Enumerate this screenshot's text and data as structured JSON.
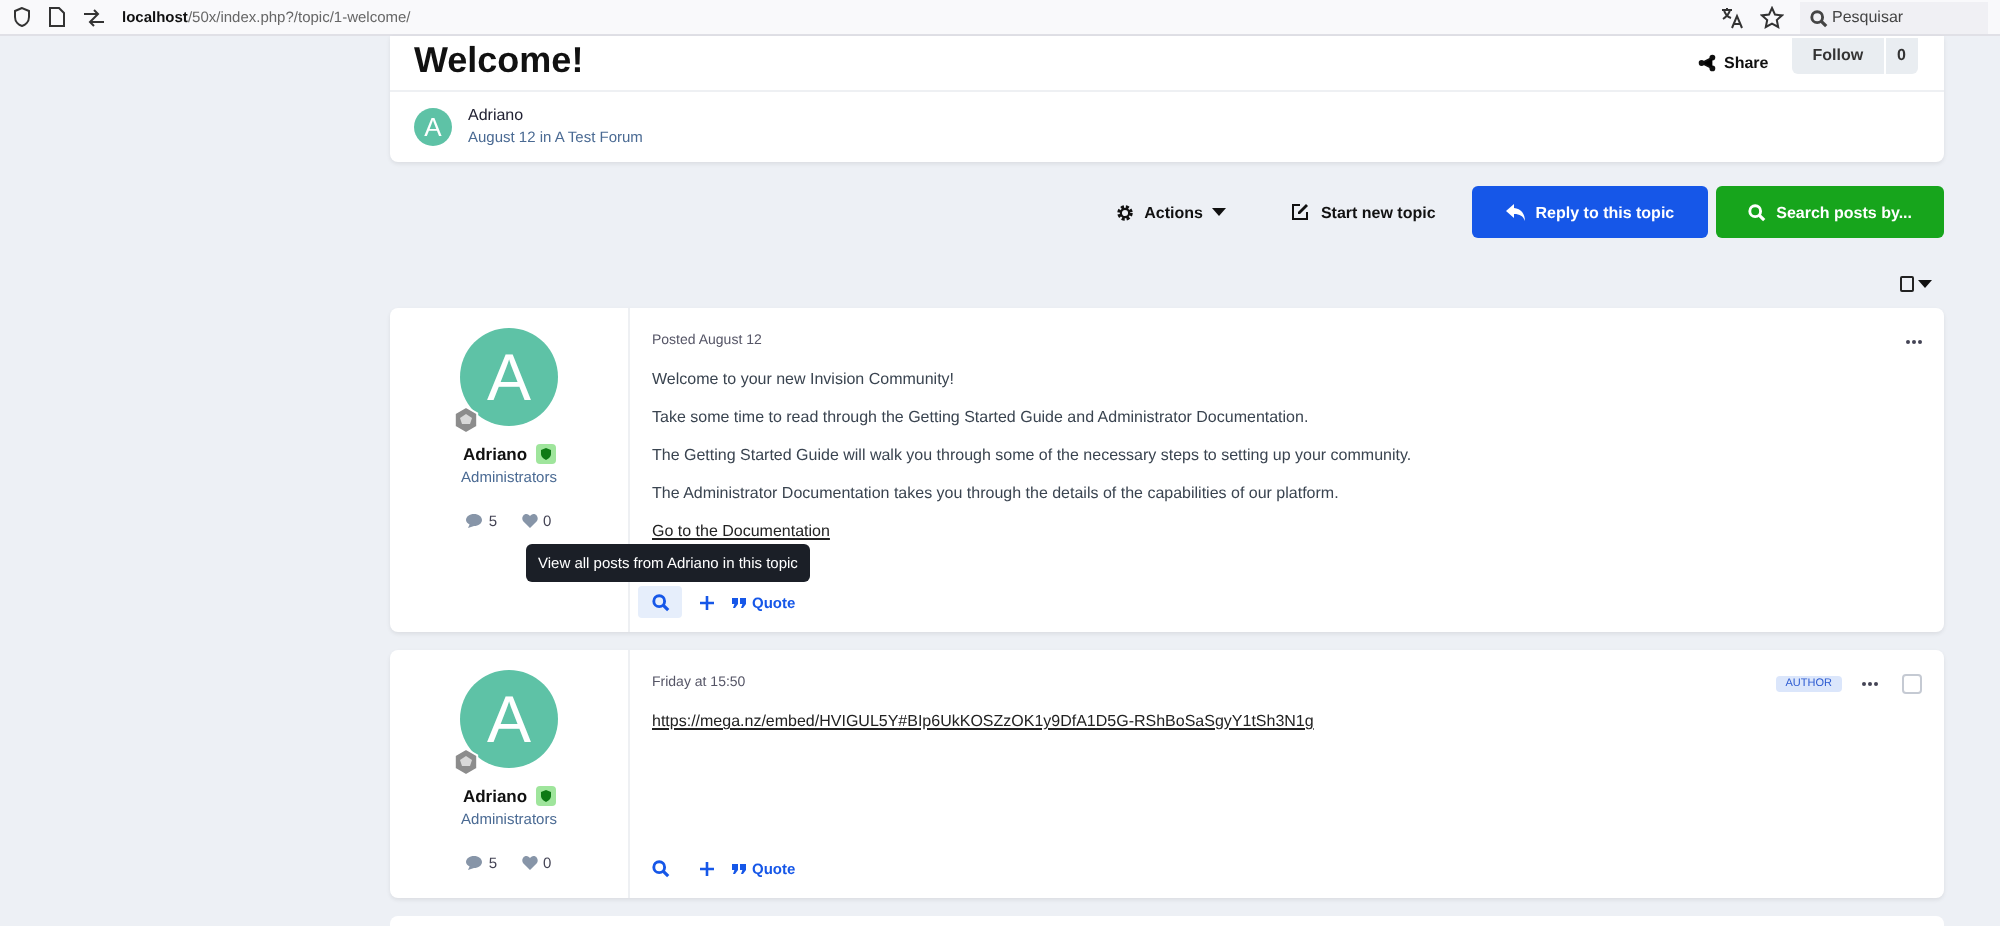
{
  "browser": {
    "url_host": "localhost",
    "url_path": "/50x/index.php?/topic/1-welcome/",
    "search_placeholder": "Pesquisar"
  },
  "topic": {
    "title": "Welcome!",
    "share": "Share",
    "follow": "Follow",
    "follow_count": "0",
    "avatar_letter": "A",
    "author": "Adriano",
    "meta": "August 12 in A Test Forum"
  },
  "actions": [
    {
      "kind": "menu",
      "label": "Actions"
    },
    {
      "kind": "plain",
      "label": "Start new topic"
    },
    {
      "kind": "primary",
      "label": "Reply to this topic"
    },
    {
      "kind": "success",
      "label": "Search posts by..."
    }
  ],
  "posts": [
    {
      "avatar_letter": "A",
      "author": "Adriano",
      "group": "Administrators",
      "replies": "5",
      "likes": "0",
      "date": "Posted August 12",
      "paragraphs": [
        {
          "kind": "text",
          "text": "Welcome to your new Invision Community!"
        },
        {
          "kind": "text",
          "text": "Take some time to read through the Getting Started Guide and Administrator Documentation."
        },
        {
          "kind": "text",
          "text": "The Getting Started Guide will walk you through some of the necessary steps to setting up your community."
        },
        {
          "kind": "text",
          "text": "The Administrator Documentation takes you through the details of the capabilities of our platform."
        },
        {
          "kind": "link",
          "text": "Go to the Documentation"
        }
      ],
      "search_highlighted": true,
      "tooltip": "View all posts from Adriano in this topic",
      "quote": "Quote"
    },
    {
      "avatar_letter": "A",
      "author": "Adriano",
      "group": "Administrators",
      "replies": "5",
      "likes": "0",
      "date": "Friday at 15:50",
      "author_badge": "AUTHOR",
      "checked": false,
      "paragraphs": [
        {
          "kind": "link",
          "text": "https://mega.nz/embed/HVIGUL5Y#BIp6UkKOSZzOK1y9DfA1D5G-RShBoSaSgyY1tSh3N1g"
        }
      ],
      "search_highlighted": false,
      "quote": "Quote"
    }
  ]
}
